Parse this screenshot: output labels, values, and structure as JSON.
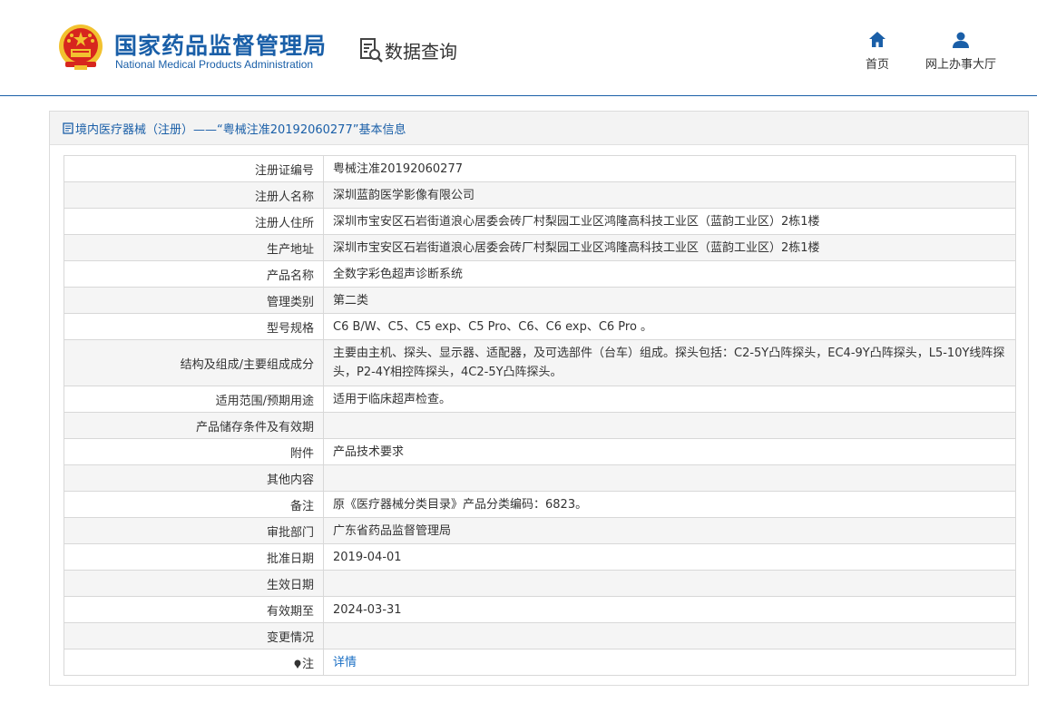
{
  "header": {
    "org_name_cn": "国家药品监督管理局",
    "org_name_en": "National Medical Products Administration",
    "query_label": "数据查询",
    "nav": [
      {
        "label": "首页",
        "icon": "home-icon"
      },
      {
        "label": "网上办事大厅",
        "icon": "user-icon"
      }
    ]
  },
  "panel": {
    "title": "境内医疗器械（注册）——“粤械注准20192060277”基本信息"
  },
  "rows": [
    {
      "label": "注册证编号",
      "value": "粤械注准20192060277"
    },
    {
      "label": "注册人名称",
      "value": "深圳蓝韵医学影像有限公司"
    },
    {
      "label": "注册人住所",
      "value": "深圳市宝安区石岩街道浪心居委会砖厂村梨园工业区鸿隆高科技工业区（蓝韵工业区）2栋1楼"
    },
    {
      "label": "生产地址",
      "value": "深圳市宝安区石岩街道浪心居委会砖厂村梨园工业区鸿隆高科技工业区（蓝韵工业区）2栋1楼"
    },
    {
      "label": "产品名称",
      "value": "全数字彩色超声诊断系统"
    },
    {
      "label": "管理类别",
      "value": "第二类"
    },
    {
      "label": "型号规格",
      "value": "C6 B/W、C5、C5 exp、C5 Pro、C6、C6 exp、C6 Pro 。"
    },
    {
      "label": "结构及组成/主要组成成分",
      "value": "主要由主机、探头、显示器、适配器，及可选部件（台车）组成。探头包括：C2-5Y凸阵探头，EC4-9Y凸阵探头，L5-10Y线阵探头，P2-4Y相控阵探头，4C2-5Y凸阵探头。"
    },
    {
      "label": "适用范围/预期用途",
      "value": "适用于临床超声检查。"
    },
    {
      "label": "产品储存条件及有效期",
      "value": ""
    },
    {
      "label": "附件",
      "value": "产品技术要求"
    },
    {
      "label": "其他内容",
      "value": ""
    },
    {
      "label": "备注",
      "value": "原《医疗器械分类目录》产品分类编码：6823。"
    },
    {
      "label": "审批部门",
      "value": "广东省药品监督管理局"
    },
    {
      "label": "批准日期",
      "value": "2019-04-01"
    },
    {
      "label": "生效日期",
      "value": ""
    },
    {
      "label": "有效期至",
      "value": "2024-03-31"
    },
    {
      "label": "变更情况",
      "value": ""
    },
    {
      "label": "注",
      "value": "详情"
    }
  ],
  "colors": {
    "brand_blue": "#1a5fa8",
    "link_blue": "#1a6fc4",
    "emblem_red": "#d7261e",
    "emblem_gold": "#f2c230"
  }
}
